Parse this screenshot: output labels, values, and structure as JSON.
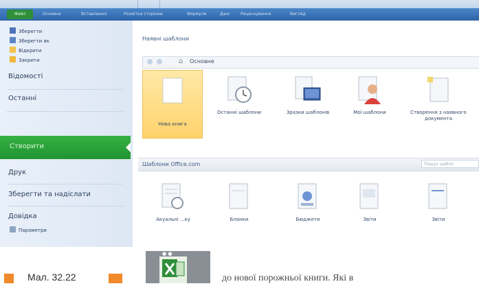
{
  "ribbon": {
    "file_label": "Файл",
    "tabs": [
      "Основне",
      "Вставлення",
      "Розмітка сторінки",
      "Формули",
      "Дані",
      "Рецензування",
      "Вигляд"
    ]
  },
  "sidebar": {
    "commands": [
      {
        "label": "Зберегти",
        "icon": "save-icon"
      },
      {
        "label": "Зберегти як",
        "icon": "save-as-icon"
      },
      {
        "label": "Відкрити",
        "icon": "folder-open-icon"
      },
      {
        "label": "Закрити",
        "icon": "folder-close-icon"
      }
    ],
    "nav": {
      "info": "Відомості",
      "recent": "Останні",
      "new": "Створити",
      "print": "Друк",
      "save_send": "Зберегти та надіслати",
      "help": "Довідка",
      "options": "Параметри"
    }
  },
  "main": {
    "available_templates": "Наявні шаблони",
    "address_path": "Основне",
    "tiles": [
      {
        "label": "Нова книга",
        "icon": "new-workbook-icon"
      },
      {
        "label": "Останні шаблони",
        "icon": "recent-templates-icon"
      },
      {
        "label": "Зразки шаблонів",
        "icon": "sample-templates-icon"
      },
      {
        "label": "Мої шаблони",
        "icon": "my-templates-icon"
      },
      {
        "label": "Створення з наявного документа",
        "icon": "new-from-existing-icon"
      }
    ],
    "office_section": "Шаблони Office.com",
    "search_placeholder": "Пошук шабло",
    "office_tiles": [
      {
        "label": "Акуальні ...ку",
        "icon": "agenda-icon"
      },
      {
        "label": "Бланки",
        "icon": "blank-forms-icon"
      },
      {
        "label": "Бюджети",
        "icon": "budgets-icon"
      },
      {
        "label": "Звіти",
        "icon": "reports-icon"
      },
      {
        "label": "Звіти",
        "icon": "reports2-icon"
      }
    ]
  },
  "caption": {
    "figure_label": "Мал. 32.22",
    "body_text": "до нової порожньої книги. Які в"
  },
  "colors": {
    "accent_green": "#1f9531",
    "ribbon_blue": "#2d64a8",
    "caption_orange": "#f08a2a"
  }
}
